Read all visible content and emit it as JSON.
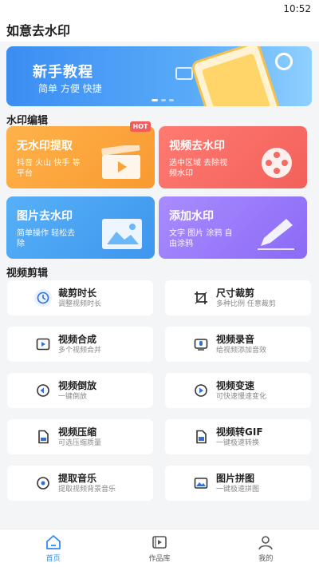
{
  "status_bar": {
    "time": "10:52"
  },
  "header": {
    "title": "如意去水印"
  },
  "banner": {
    "title": "新手教程",
    "subtitle": "简单 方便 快捷"
  },
  "sections": {
    "watermark": "水印编辑",
    "video": "视频剪辑"
  },
  "watermark_cards": [
    {
      "title": "无水印提取",
      "sub": "抖音 火山 快手 等平台",
      "badge": "HOT"
    },
    {
      "title": "视频去水印",
      "sub": "选中区域 去除视频水印"
    },
    {
      "title": "图片去水印",
      "sub": "简单操作 轻松去除"
    },
    {
      "title": "添加水印",
      "sub": "文字 图片 涂鸦 自由涂鸦"
    }
  ],
  "video_tools": [
    {
      "title": "裁剪时长",
      "sub": "调整视频时长",
      "icon": "clock-icon"
    },
    {
      "title": "尺寸裁剪",
      "sub": "多种比例 任意裁剪",
      "icon": "crop-icon"
    },
    {
      "title": "视频合成",
      "sub": "多个视频合并",
      "icon": "video-merge-icon"
    },
    {
      "title": "视频录音",
      "sub": "给视频添加音效",
      "icon": "microphone-icon"
    },
    {
      "title": "视频倒放",
      "sub": "一键倒放",
      "icon": "rewind-icon"
    },
    {
      "title": "视频变速",
      "sub": "可快速慢速变化",
      "icon": "speed-icon"
    },
    {
      "title": "视频压缩",
      "sub": "可选压缩质量",
      "icon": "compress-icon"
    },
    {
      "title": "视频转GIF",
      "sub": "一键极速转换",
      "icon": "gif-icon"
    },
    {
      "title": "提取音乐",
      "sub": "提取视频背景音乐",
      "icon": "music-icon"
    },
    {
      "title": "图片拼图",
      "sub": "一键极速拼图",
      "icon": "collage-icon"
    }
  ],
  "tabs": [
    {
      "label": "首页",
      "icon": "home-icon",
      "active": true
    },
    {
      "label": "作品库",
      "icon": "library-icon",
      "active": false
    },
    {
      "label": "我的",
      "icon": "profile-icon",
      "active": false
    }
  ],
  "colors": {
    "accent": "#2f8af5",
    "orange": "#f89a30",
    "red": "#f2615a",
    "blue": "#3e96ef",
    "purple": "#8b6af5"
  }
}
